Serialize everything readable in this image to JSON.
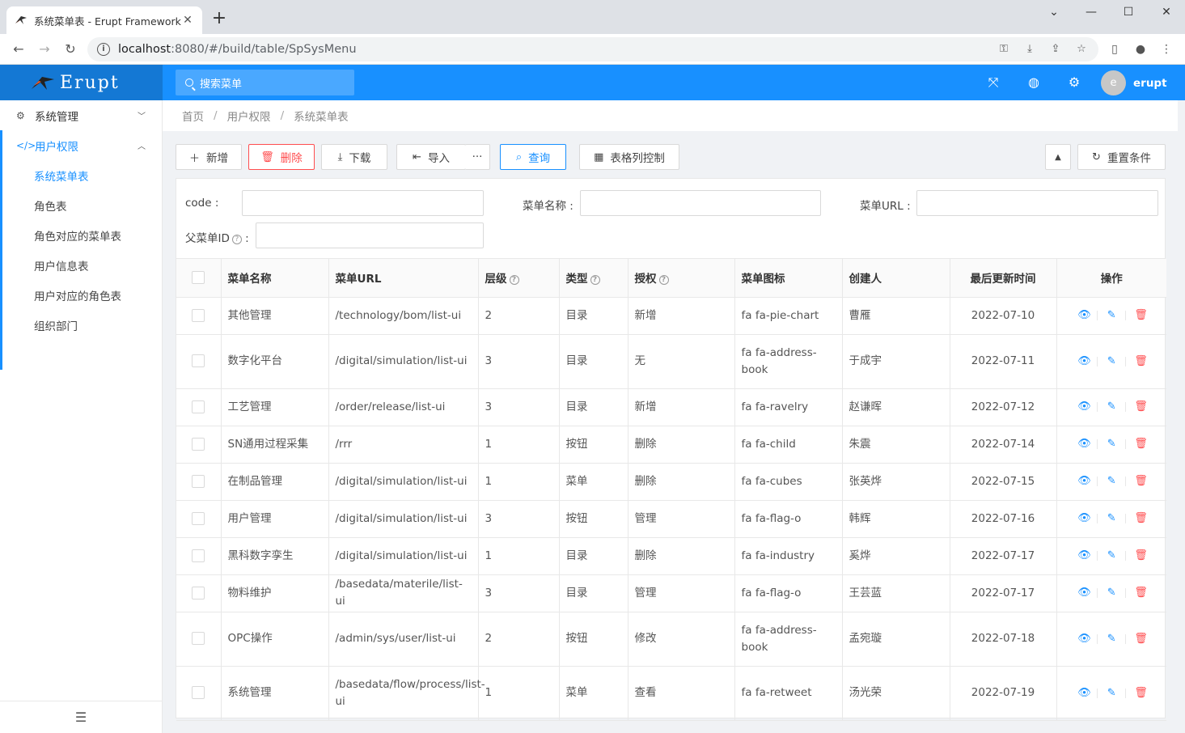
{
  "browser": {
    "tab_title": "系统菜单表 - Erupt Framework",
    "tab_close": "✕",
    "new_tab": "+",
    "url_host": "localhost",
    "url_rest": ":8080/#/build/table/SpSysMenu"
  },
  "header": {
    "logo_text": "Erupt",
    "search_placeholder": "搜索菜单",
    "user_initial": "e",
    "user_name": "erupt"
  },
  "sidebar": {
    "groups": [
      {
        "label": "系统管理"
      },
      {
        "label": "用户权限"
      }
    ],
    "items": [
      {
        "label": "系统菜单表"
      },
      {
        "label": "角色表"
      },
      {
        "label": "角色对应的菜单表"
      },
      {
        "label": "用户信息表"
      },
      {
        "label": "用户对应的角色表"
      },
      {
        "label": "组织部门"
      }
    ]
  },
  "breadcrumb": [
    "首页",
    "用户权限",
    "系统菜单表"
  ],
  "toolbar": {
    "add": "新增",
    "delete": "删除",
    "download": "下载",
    "import": "导入",
    "more": "···",
    "query": "查询",
    "columns": "表格列控制",
    "reset": "重置条件"
  },
  "filter": {
    "code_label": "code :",
    "name_label": "菜单名称 :",
    "url_label": "菜单URL :",
    "parent_label": "父菜单ID",
    "parent_colon": " :"
  },
  "table": {
    "headers": [
      "菜单名称",
      "菜单URL",
      "层级",
      "类型",
      "授权",
      "菜单图标",
      "创建人",
      "最后更新时间",
      "操作"
    ],
    "rows": [
      {
        "name": "其他管理",
        "url": "/technology/bom/list-ui",
        "level": "2",
        "type": "目录",
        "auth": "新增",
        "icon": "fa fa-pie-chart",
        "creator": "曹雁",
        "updated": "2022-07-10"
      },
      {
        "name": "数字化平台",
        "url": "/digital/simulation/list-ui",
        "level": "3",
        "type": "目录",
        "auth": "无",
        "icon": "fa fa-address-book",
        "creator": "于成宇",
        "updated": "2022-07-11"
      },
      {
        "name": "工艺管理",
        "url": "/order/release/list-ui",
        "level": "3",
        "type": "目录",
        "auth": "新增",
        "icon": "fa fa-ravelry",
        "creator": "赵谦晖",
        "updated": "2022-07-12"
      },
      {
        "name": "SN通用过程采集",
        "url": "/rrr",
        "level": "1",
        "type": "按钮",
        "auth": "删除",
        "icon": "fa fa-child",
        "creator": "朱震",
        "updated": "2022-07-14"
      },
      {
        "name": "在制品管理",
        "url": "/digital/simulation/list-ui",
        "level": "1",
        "type": "菜单",
        "auth": "删除",
        "icon": "fa fa-cubes",
        "creator": "张英烨",
        "updated": "2022-07-15"
      },
      {
        "name": "用户管理",
        "url": "/digital/simulation/list-ui",
        "level": "3",
        "type": "按钮",
        "auth": "管理",
        "icon": "fa fa-flag-o",
        "creator": "韩辉",
        "updated": "2022-07-16"
      },
      {
        "name": "黑科数字孪生",
        "url": "/digital/simulation/list-ui",
        "level": "1",
        "type": "目录",
        "auth": "删除",
        "icon": "fa fa-industry",
        "creator": "奚烨",
        "updated": "2022-07-17"
      },
      {
        "name": "物料维护",
        "url": "/basedata/materile/list-ui",
        "level": "3",
        "type": "目录",
        "auth": "管理",
        "icon": "fa fa-flag-o",
        "creator": "王芸蓝",
        "updated": "2022-07-17"
      },
      {
        "name": "OPC操作",
        "url": "/admin/sys/user/list-ui",
        "level": "2",
        "type": "按钮",
        "auth": "修改",
        "icon": "fa fa-address-book",
        "creator": "孟宛璇",
        "updated": "2022-07-18"
      },
      {
        "name": "系统管理",
        "url": "/basedata/flow/process/list-ui",
        "level": "1",
        "type": "菜单",
        "auth": "查看",
        "icon": "fa fa-retweet",
        "creator": "汤光荣",
        "updated": "2022-07-19"
      }
    ]
  },
  "colors": {
    "primary": "#1890ff",
    "danger": "#ff4d4f",
    "logo_bg": "#1478d4"
  }
}
